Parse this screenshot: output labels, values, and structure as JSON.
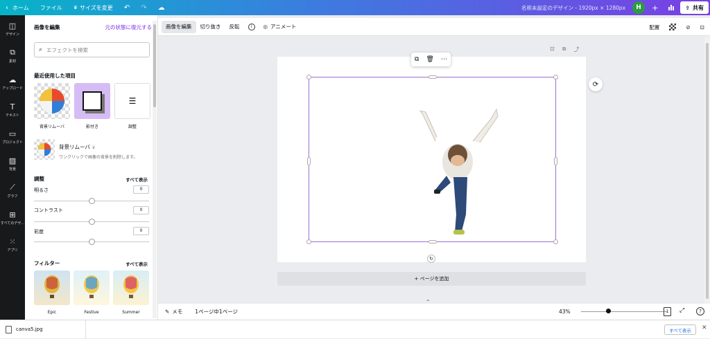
{
  "topbar": {
    "home": "ホーム",
    "file": "ファイル",
    "resize": "サイズを変更",
    "doc_title": "名称未設定のデザイン - 1920px × 1280px",
    "avatar_initial": "H",
    "share": "共有"
  },
  "rail": {
    "items": [
      {
        "label": "デザイン",
        "icon": "design-icon"
      },
      {
        "label": "素材",
        "icon": "elements-icon"
      },
      {
        "label": "アップロード",
        "icon": "upload-icon"
      },
      {
        "label": "テキスト",
        "icon": "text-icon"
      },
      {
        "label": "プロジェクト",
        "icon": "folder-icon"
      },
      {
        "label": "背景",
        "icon": "background-icon"
      },
      {
        "label": "グラフ",
        "icon": "chart-icon"
      },
      {
        "label": "すべてのデザ...",
        "icon": "all-designs-icon"
      },
      {
        "label": "アプリ",
        "icon": "apps-icon"
      }
    ]
  },
  "panel": {
    "title": "画像を編集",
    "restore": "元の状態に復元する",
    "search_placeholder": "エフェクトを検索",
    "recent_title": "最近使用した項目",
    "recent": [
      {
        "label": "背景リムーバ"
      },
      {
        "label": "影付き"
      },
      {
        "label": "調整"
      }
    ],
    "bg_remover": {
      "title": "背景リムーバ",
      "desc": "ワンクリックで画像の背景を削除します。"
    },
    "adjust": {
      "title": "調整",
      "show_all": "すべて表示",
      "items": [
        {
          "label": "明るさ",
          "value": "0"
        },
        {
          "label": "コントラスト",
          "value": "0"
        },
        {
          "label": "彩度",
          "value": "0"
        }
      ]
    },
    "filters": {
      "title": "フィルター",
      "show_all": "すべて表示",
      "items": [
        {
          "label": "Epic"
        },
        {
          "label": "Festive"
        },
        {
          "label": "Summer"
        }
      ]
    }
  },
  "context_toolbar": {
    "edit_image": "画像を編集",
    "crop": "切り抜き",
    "flip": "反転",
    "animate": "アニメート",
    "position": "配置"
  },
  "canvas": {
    "add_page": "+ ページを追加"
  },
  "bottombar": {
    "notes": "メモ",
    "page_indicator": "1ページ中1ページ",
    "zoom": "43%",
    "page_count": "1",
    "zoom_level": 0.43
  },
  "download_bar": {
    "filename": "canva5.jpg",
    "show_all": "すべて表示"
  },
  "colors": {
    "accent": "#7d2ae8",
    "selection": "#9b6dd6",
    "rail_bg": "#18191b"
  }
}
